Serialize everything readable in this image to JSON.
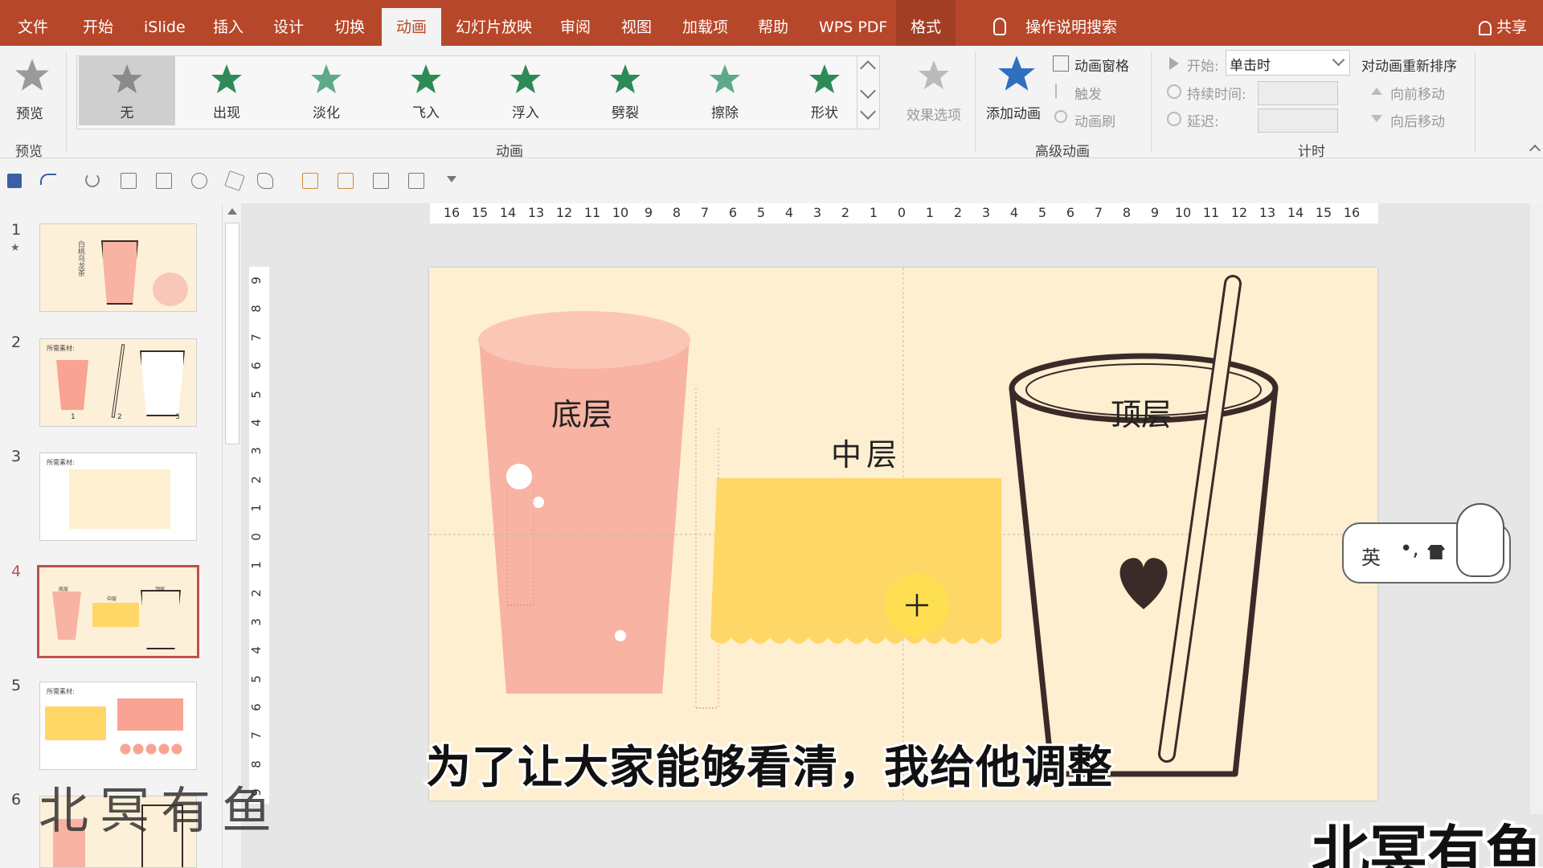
{
  "menubar": {
    "items": [
      "文件",
      "开始",
      "iSlide",
      "插入",
      "设计",
      "切换",
      "动画",
      "幻灯片放映",
      "审阅",
      "视图",
      "加载项",
      "帮助",
      "WPS PDF",
      "格式"
    ],
    "active": "动画",
    "search": "操作说明搜索",
    "share": "共享"
  },
  "ribbon": {
    "preview": {
      "label": "预览",
      "group": "预览"
    },
    "animations": {
      "group": "动画",
      "items": [
        "无",
        "出现",
        "淡化",
        "飞入",
        "浮入",
        "劈裂",
        "擦除",
        "形状"
      ],
      "effect_options": "效果选项"
    },
    "advanced": {
      "group": "高级动画",
      "add_animation": "添加动画",
      "animation_pane": "动画窗格",
      "trigger": "触发",
      "animation_painter": "动画刷"
    },
    "timing": {
      "group": "计时",
      "start_label": "开始:",
      "start_value": "单击时",
      "duration_label": "持续时间:",
      "delay_label": "延迟:",
      "reorder": "对动画重新排序",
      "move_earlier": "向前移动",
      "move_later": "向后移动"
    }
  },
  "thumbnails": {
    "numbers": [
      "1",
      "2",
      "3",
      "4",
      "5",
      "6"
    ],
    "selected": 4,
    "slide2_title": "所需素材:",
    "slide3_title": "所需素材:",
    "slide5_title": "所需素材:",
    "slide1_text": "白桃乌龙茶",
    "slide2_nums": [
      "1",
      "2",
      "3"
    ],
    "slide4_labels": [
      "底层",
      "中层",
      "顶层"
    ]
  },
  "ruler": {
    "h_ticks": [
      "16",
      "15",
      "14",
      "13",
      "12",
      "11",
      "10",
      "9",
      "8",
      "7",
      "6",
      "5",
      "4",
      "3",
      "2",
      "1",
      "0",
      "1",
      "2",
      "3",
      "4",
      "5",
      "6",
      "7",
      "8",
      "9",
      "10",
      "11",
      "12",
      "13",
      "14",
      "15",
      "16"
    ],
    "v_ticks": [
      "9",
      "8",
      "7",
      "6",
      "5",
      "4",
      "3",
      "2",
      "1",
      "0",
      "1",
      "2",
      "3",
      "4",
      "5",
      "6",
      "7",
      "8",
      "9"
    ]
  },
  "slide": {
    "bottom_label": "底层",
    "middle_label": "中层",
    "top_label": "顶层"
  },
  "ime": {
    "text": "英"
  },
  "subtitle": "为了让大家能够看清，我给他调整",
  "watermark": "北冥有鱼",
  "logo": "北冥有鱼",
  "colors": {
    "accent": "#b7472a",
    "slide_bg": "#feefd1",
    "cup_pink": "#f8b3a3",
    "middle_yellow": "#ffd766"
  }
}
